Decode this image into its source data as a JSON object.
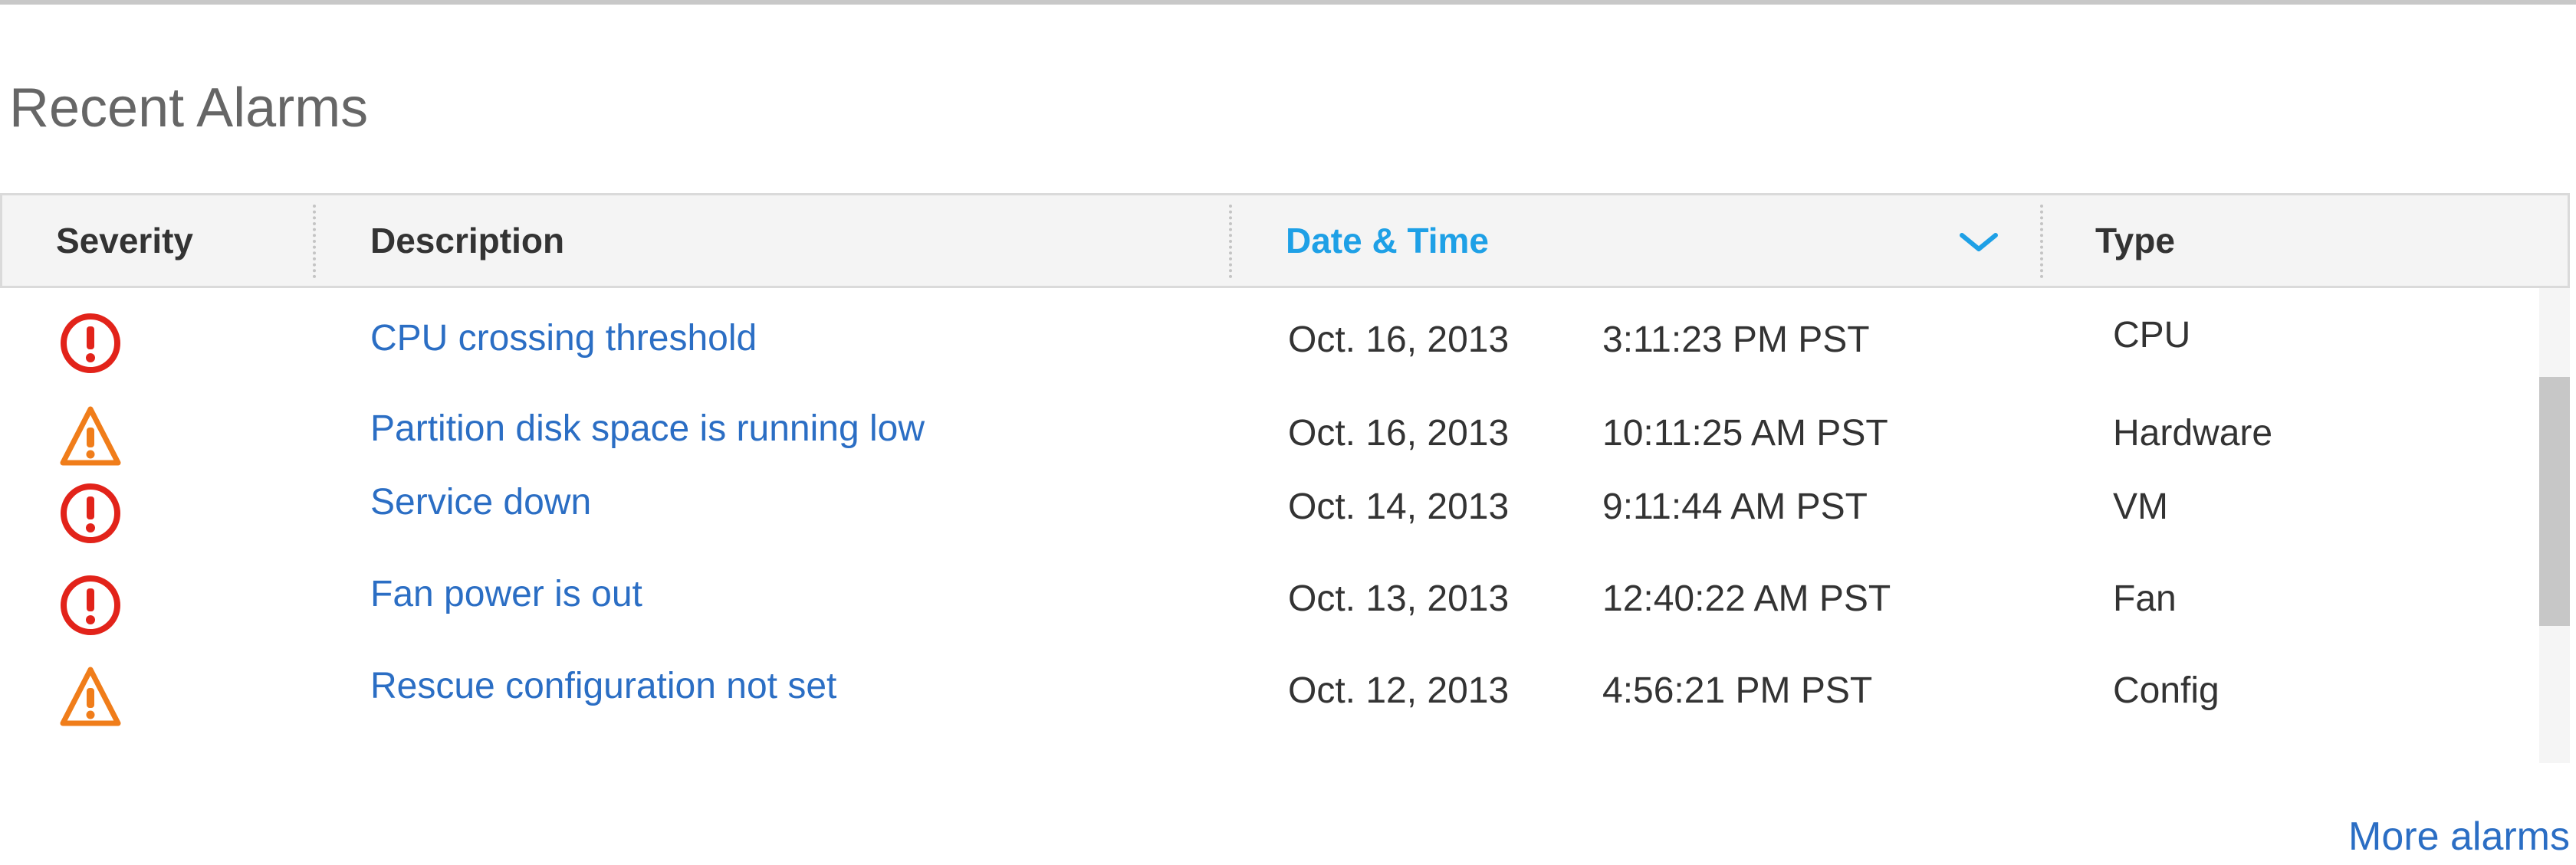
{
  "section": {
    "title": "Recent Alarms"
  },
  "table": {
    "columns": {
      "severity": "Severity",
      "description": "Description",
      "datetime": "Date & Time",
      "type": "Type"
    },
    "sort": {
      "column": "Date & Time",
      "direction": "descending"
    },
    "rows": [
      {
        "severity": "critical",
        "icon": "critical-alarm-icon",
        "description": "CPU crossing threshold",
        "date": "Oct. 16, 2013",
        "time": "3:11:23 PM PST",
        "type": "CPU"
      },
      {
        "severity": "warning",
        "icon": "warning-alarm-icon",
        "description": "Partition disk space is running low",
        "date": "Oct. 16, 2013",
        "time": "10:11:25 AM PST",
        "type": "Hardware"
      },
      {
        "severity": "critical",
        "icon": "critical-alarm-icon",
        "description": "Service down",
        "date": "Oct. 14, 2013",
        "time": "9:11:44 AM PST",
        "type": "VM"
      },
      {
        "severity": "critical",
        "icon": "critical-alarm-icon",
        "description": "Fan power is out",
        "date": "Oct. 13, 2013",
        "time": "12:40:22 AM PST",
        "type": "Fan"
      },
      {
        "severity": "warning",
        "icon": "warning-alarm-icon",
        "description": "Rescue configuration not set",
        "date": "Oct. 12, 2013",
        "time": "4:56:21 PM PST",
        "type": "Config"
      }
    ]
  },
  "footer": {
    "more_link": "More alarms"
  },
  "colors": {
    "critical": "#e2231a",
    "warning": "#f07d1a",
    "link": "#2b6ec4",
    "sorted_header": "#1ea0e6",
    "header_bg": "#f4f4f4"
  }
}
